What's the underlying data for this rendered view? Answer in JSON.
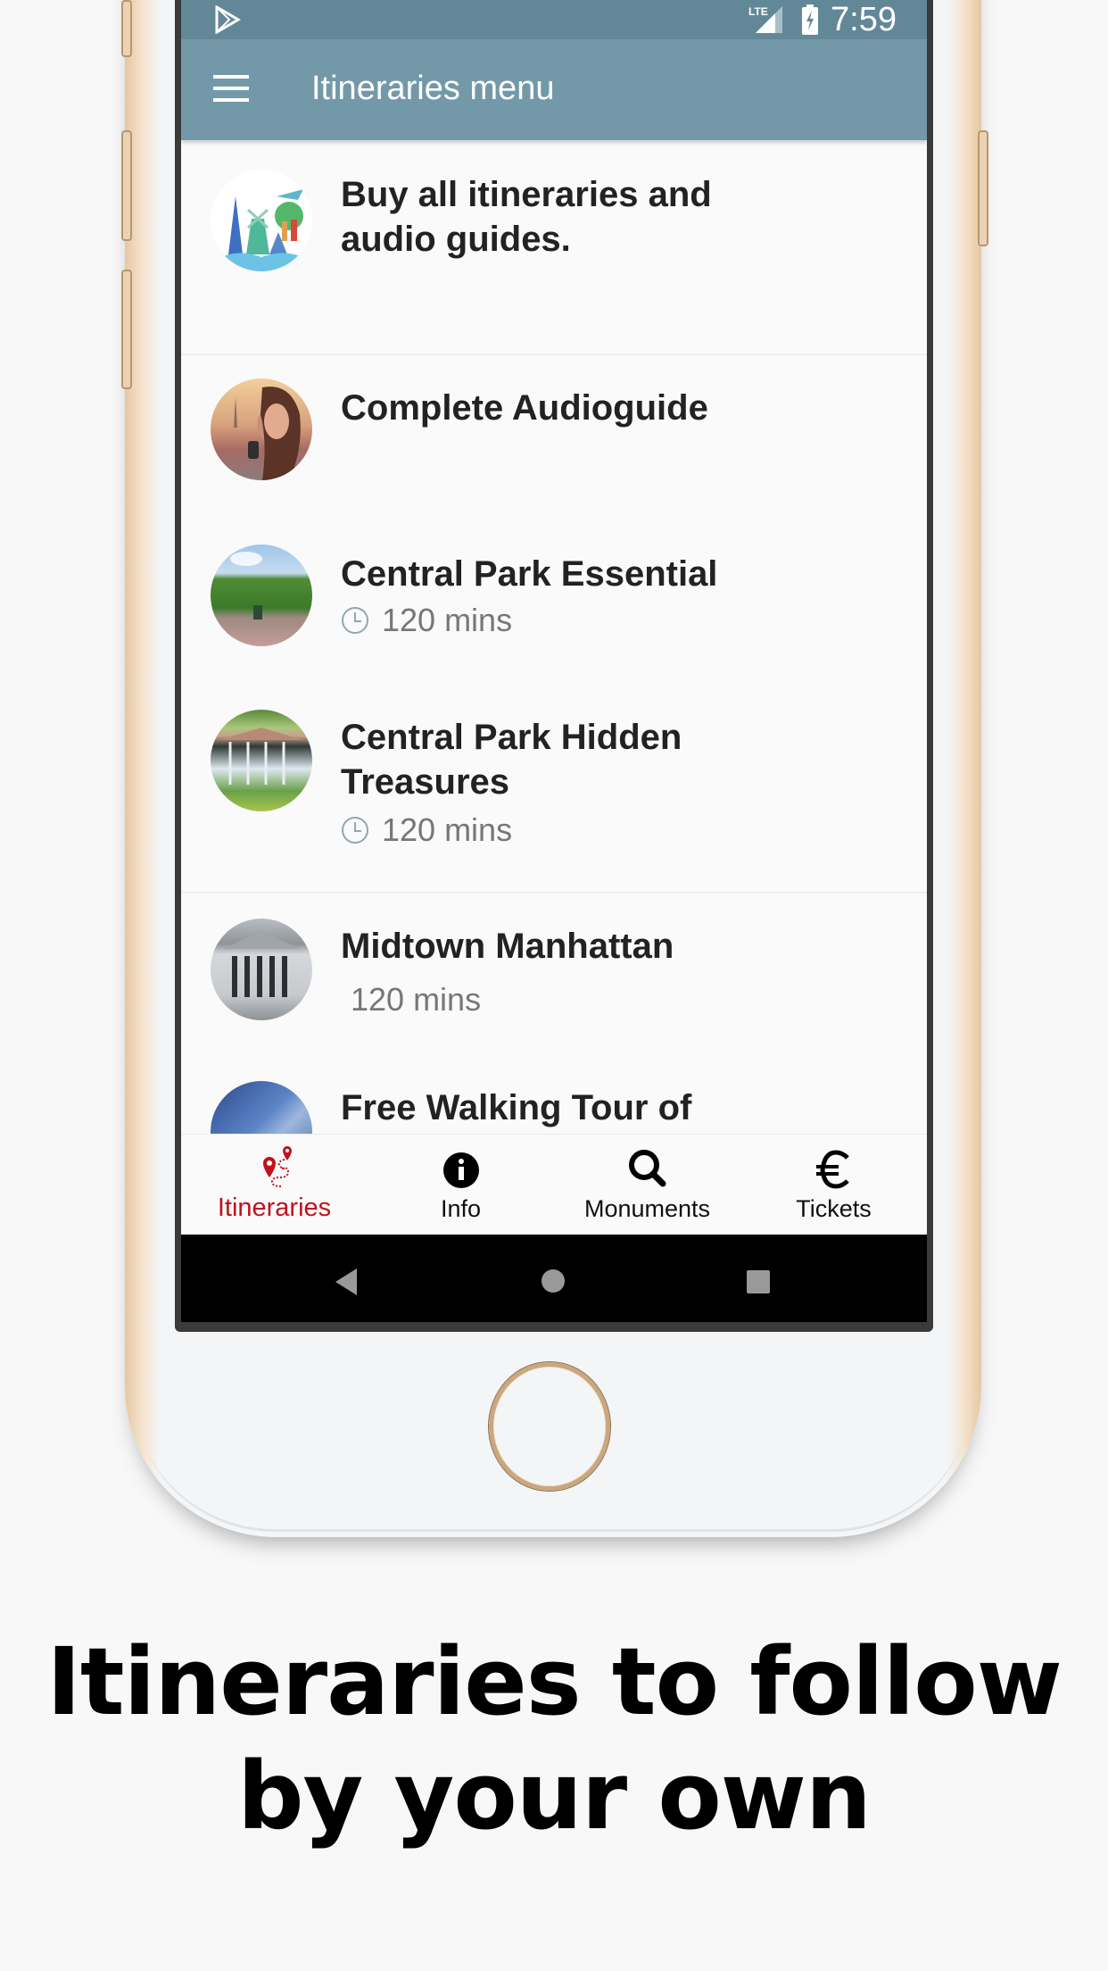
{
  "status_bar": {
    "time": "7:59",
    "network": "LTE",
    "icons": [
      "play-store-icon",
      "signal-icon",
      "battery-charging-icon"
    ]
  },
  "toolbar": {
    "title": "Itineraries menu",
    "menu_icon": "hamburger-menu-icon"
  },
  "list": {
    "items": [
      {
        "title": "Buy all itineraries and audio guides.",
        "duration": null,
        "image": "travel-illustration"
      },
      {
        "title": "Complete Audioguide",
        "duration": null,
        "image": "woman-headphones-photo"
      },
      {
        "title": "Central Park Essential",
        "duration": "120 mins",
        "image": "central-park-fountain-photo"
      },
      {
        "title": "Central Park Hidden Treasures",
        "duration": "120 mins",
        "image": "gazebo-photo"
      },
      {
        "title": "Midtown Manhattan",
        "duration": "120 mins",
        "image": "stock-exchange-photo"
      },
      {
        "title": "Free Walking Tour of",
        "duration": null,
        "image": "glass-building-photo"
      }
    ]
  },
  "bottom_nav": {
    "items": [
      {
        "label": "Itineraries",
        "icon": "itinerary-route-icon",
        "active": true
      },
      {
        "label": "Info",
        "icon": "info-icon",
        "active": false
      },
      {
        "label": "Monuments",
        "icon": "search-icon",
        "active": false
      },
      {
        "label": "Tickets",
        "icon": "euro-icon",
        "active": false
      }
    ],
    "active_color": "#c0121c"
  },
  "colors": {
    "status_bar": "#628898",
    "toolbar": "#7399a8",
    "accent": "#c0121c"
  },
  "caption": {
    "line1": "Itineraries to follow",
    "line2": "by your own"
  }
}
